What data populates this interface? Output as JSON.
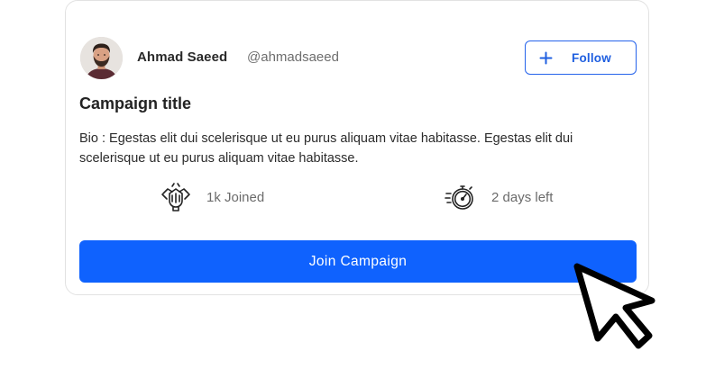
{
  "user": {
    "name": "Ahmad Saeed",
    "handle": "@ahmadsaeed",
    "avatar_icon": "user-avatar-photo"
  },
  "follow_button": {
    "icon": "plus-icon",
    "label": "Follow"
  },
  "campaign": {
    "title": "Campaign title",
    "bio": "Bio : Egestas elit dui scelerisque ut eu purus aliquam vitae habitasse. Egestas elit dui scelerisque ut eu purus aliquam vitae habitasse."
  },
  "stats": {
    "joined": {
      "icon": "handshake-group-icon",
      "text": "1k Joined"
    },
    "time_left": {
      "icon": "stopwatch-icon",
      "text": "2 days left"
    }
  },
  "join_button": {
    "label": "Join Campaign"
  },
  "cursor_icon": "mouse-pointer-icon",
  "colors": {
    "primary": "#0f62fe",
    "follow_border": "#2563eb",
    "card_border": "#e2e2e2",
    "muted_text": "#6b6b6b"
  }
}
